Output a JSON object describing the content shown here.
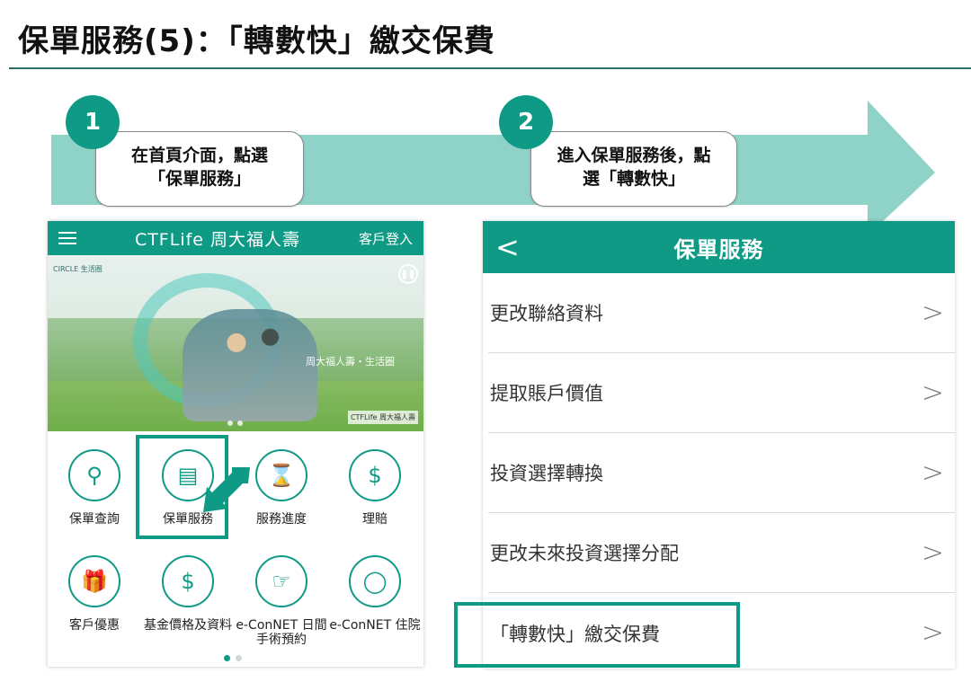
{
  "header": {
    "title": "保單服務(5)：「轉數快」繳交保費"
  },
  "steps": [
    {
      "number": "1",
      "line1": "在首頁介面，點選",
      "line2": "「保單服務」"
    },
    {
      "number": "2",
      "line1": "進入保單服務後，點",
      "line2": "選「轉數快」"
    }
  ],
  "app": {
    "brand": "CTFLife 周大福人壽",
    "login": "客戶登入",
    "banner": {
      "circle_logo": "CIRCLE 生活圈",
      "slogan_line1": "周大福人壽・生活圈",
      "mini_logo": "CTFLife 周大福人壽"
    },
    "tiles": [
      {
        "label": "保單查詢",
        "icon": "search-icon"
      },
      {
        "label": "保單服務",
        "icon": "document-icon"
      },
      {
        "label": "服務進度",
        "icon": "hourglass-icon"
      },
      {
        "label": "理賠",
        "icon": "shield-dollar-icon"
      },
      {
        "label": "客戶優惠",
        "icon": "gift-icon"
      },
      {
        "label": "基金價格及資料",
        "icon": "dollar-cycle-icon"
      },
      {
        "label": "e-ConNET 日間手術預約",
        "icon": "book-hand-icon"
      },
      {
        "label": "e-ConNET 住院",
        "icon": "location-pin-icon"
      }
    ]
  },
  "service_panel": {
    "title": "保單服務",
    "items": [
      {
        "label": "更改聯絡資料"
      },
      {
        "label": "提取賬戶價值"
      },
      {
        "label": "投資選擇轉換"
      },
      {
        "label": "更改未來投資選擇分配"
      },
      {
        "label": "「轉數快」繳交保費"
      }
    ]
  },
  "colors": {
    "accent": "#0f9a86",
    "arrow": "#8fd3c8"
  }
}
